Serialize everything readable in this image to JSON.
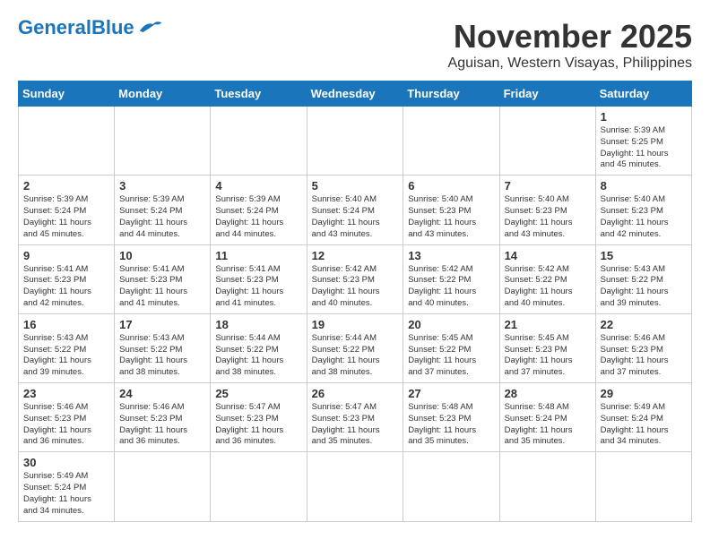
{
  "header": {
    "logo_general": "General",
    "logo_blue": "Blue",
    "month_title": "November 2025",
    "location": "Aguisan, Western Visayas, Philippines"
  },
  "weekdays": [
    "Sunday",
    "Monday",
    "Tuesday",
    "Wednesday",
    "Thursday",
    "Friday",
    "Saturday"
  ],
  "weeks": [
    [
      {
        "day": "",
        "info": ""
      },
      {
        "day": "",
        "info": ""
      },
      {
        "day": "",
        "info": ""
      },
      {
        "day": "",
        "info": ""
      },
      {
        "day": "",
        "info": ""
      },
      {
        "day": "",
        "info": ""
      },
      {
        "day": "1",
        "info": "Sunrise: 5:39 AM\nSunset: 5:25 PM\nDaylight: 11 hours\nand 45 minutes."
      }
    ],
    [
      {
        "day": "2",
        "info": "Sunrise: 5:39 AM\nSunset: 5:24 PM\nDaylight: 11 hours\nand 45 minutes."
      },
      {
        "day": "3",
        "info": "Sunrise: 5:39 AM\nSunset: 5:24 PM\nDaylight: 11 hours\nand 44 minutes."
      },
      {
        "day": "4",
        "info": "Sunrise: 5:39 AM\nSunset: 5:24 PM\nDaylight: 11 hours\nand 44 minutes."
      },
      {
        "day": "5",
        "info": "Sunrise: 5:40 AM\nSunset: 5:24 PM\nDaylight: 11 hours\nand 43 minutes."
      },
      {
        "day": "6",
        "info": "Sunrise: 5:40 AM\nSunset: 5:23 PM\nDaylight: 11 hours\nand 43 minutes."
      },
      {
        "day": "7",
        "info": "Sunrise: 5:40 AM\nSunset: 5:23 PM\nDaylight: 11 hours\nand 43 minutes."
      },
      {
        "day": "8",
        "info": "Sunrise: 5:40 AM\nSunset: 5:23 PM\nDaylight: 11 hours\nand 42 minutes."
      }
    ],
    [
      {
        "day": "9",
        "info": "Sunrise: 5:41 AM\nSunset: 5:23 PM\nDaylight: 11 hours\nand 42 minutes."
      },
      {
        "day": "10",
        "info": "Sunrise: 5:41 AM\nSunset: 5:23 PM\nDaylight: 11 hours\nand 41 minutes."
      },
      {
        "day": "11",
        "info": "Sunrise: 5:41 AM\nSunset: 5:23 PM\nDaylight: 11 hours\nand 41 minutes."
      },
      {
        "day": "12",
        "info": "Sunrise: 5:42 AM\nSunset: 5:23 PM\nDaylight: 11 hours\nand 40 minutes."
      },
      {
        "day": "13",
        "info": "Sunrise: 5:42 AM\nSunset: 5:22 PM\nDaylight: 11 hours\nand 40 minutes."
      },
      {
        "day": "14",
        "info": "Sunrise: 5:42 AM\nSunset: 5:22 PM\nDaylight: 11 hours\nand 40 minutes."
      },
      {
        "day": "15",
        "info": "Sunrise: 5:43 AM\nSunset: 5:22 PM\nDaylight: 11 hours\nand 39 minutes."
      }
    ],
    [
      {
        "day": "16",
        "info": "Sunrise: 5:43 AM\nSunset: 5:22 PM\nDaylight: 11 hours\nand 39 minutes."
      },
      {
        "day": "17",
        "info": "Sunrise: 5:43 AM\nSunset: 5:22 PM\nDaylight: 11 hours\nand 38 minutes."
      },
      {
        "day": "18",
        "info": "Sunrise: 5:44 AM\nSunset: 5:22 PM\nDaylight: 11 hours\nand 38 minutes."
      },
      {
        "day": "19",
        "info": "Sunrise: 5:44 AM\nSunset: 5:22 PM\nDaylight: 11 hours\nand 38 minutes."
      },
      {
        "day": "20",
        "info": "Sunrise: 5:45 AM\nSunset: 5:22 PM\nDaylight: 11 hours\nand 37 minutes."
      },
      {
        "day": "21",
        "info": "Sunrise: 5:45 AM\nSunset: 5:23 PM\nDaylight: 11 hours\nand 37 minutes."
      },
      {
        "day": "22",
        "info": "Sunrise: 5:46 AM\nSunset: 5:23 PM\nDaylight: 11 hours\nand 37 minutes."
      }
    ],
    [
      {
        "day": "23",
        "info": "Sunrise: 5:46 AM\nSunset: 5:23 PM\nDaylight: 11 hours\nand 36 minutes."
      },
      {
        "day": "24",
        "info": "Sunrise: 5:46 AM\nSunset: 5:23 PM\nDaylight: 11 hours\nand 36 minutes."
      },
      {
        "day": "25",
        "info": "Sunrise: 5:47 AM\nSunset: 5:23 PM\nDaylight: 11 hours\nand 36 minutes."
      },
      {
        "day": "26",
        "info": "Sunrise: 5:47 AM\nSunset: 5:23 PM\nDaylight: 11 hours\nand 35 minutes."
      },
      {
        "day": "27",
        "info": "Sunrise: 5:48 AM\nSunset: 5:23 PM\nDaylight: 11 hours\nand 35 minutes."
      },
      {
        "day": "28",
        "info": "Sunrise: 5:48 AM\nSunset: 5:24 PM\nDaylight: 11 hours\nand 35 minutes."
      },
      {
        "day": "29",
        "info": "Sunrise: 5:49 AM\nSunset: 5:24 PM\nDaylight: 11 hours\nand 34 minutes."
      }
    ],
    [
      {
        "day": "30",
        "info": "Sunrise: 5:49 AM\nSunset: 5:24 PM\nDaylight: 11 hours\nand 34 minutes."
      },
      {
        "day": "",
        "info": ""
      },
      {
        "day": "",
        "info": ""
      },
      {
        "day": "",
        "info": ""
      },
      {
        "day": "",
        "info": ""
      },
      {
        "day": "",
        "info": ""
      },
      {
        "day": "",
        "info": ""
      }
    ]
  ]
}
